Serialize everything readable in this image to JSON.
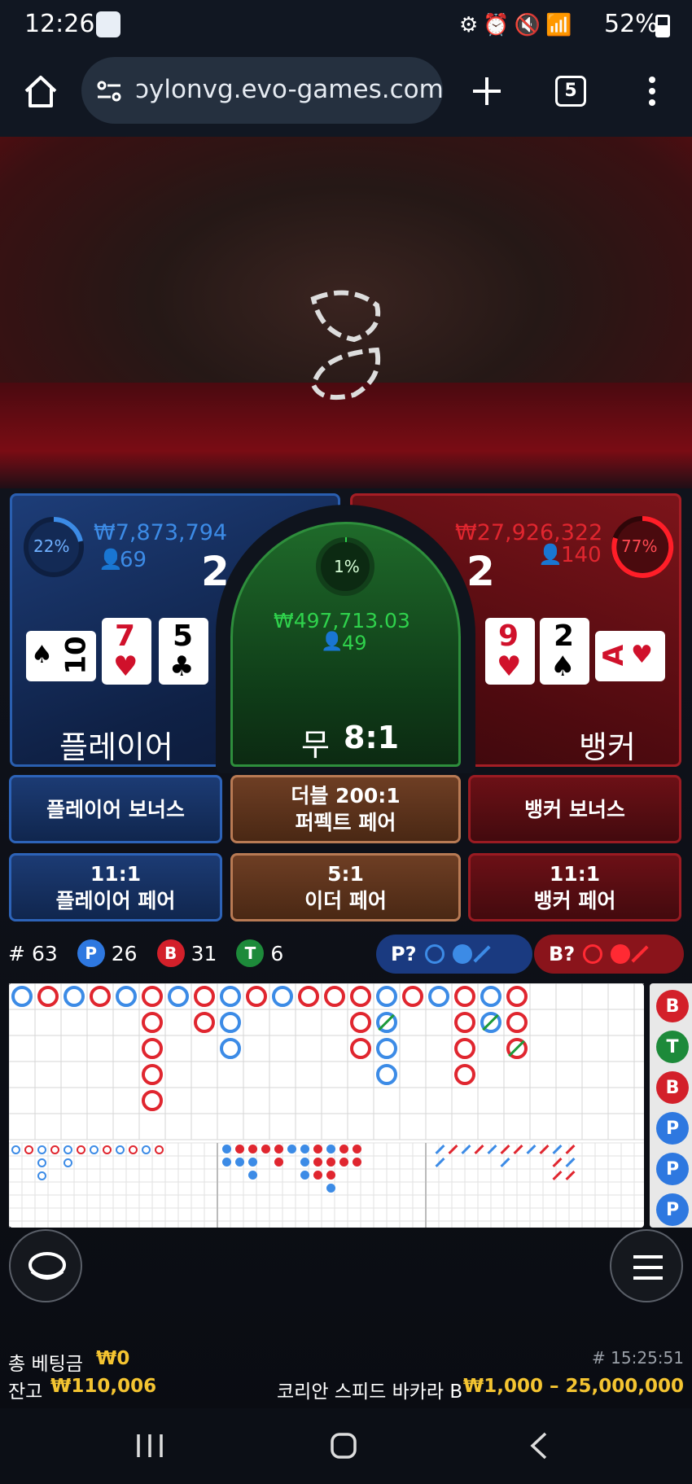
{
  "status_bar": {
    "time": "12:26",
    "battery": "52%"
  },
  "browser": {
    "url": "ɔylonvg.evo-games.com",
    "tab_count": "5"
  },
  "player": {
    "percent": "22%",
    "amount": "₩7,873,794",
    "bettors": "69",
    "score": "2",
    "label": "플레이어",
    "cards": [
      {
        "rank": "10",
        "suit": "♠",
        "color": "#000",
        "rotated": true
      },
      {
        "rank": "7",
        "suit": "♥",
        "color": "#d0112b"
      },
      {
        "rank": "5",
        "suit": "♣",
        "color": "#000"
      }
    ]
  },
  "tie": {
    "percent": "1%",
    "amount": "₩497,713.03",
    "bettors": "49",
    "label": "무",
    "odds": "8:1"
  },
  "banker": {
    "percent": "77%",
    "amount": "₩27,926,322",
    "bettors": "140",
    "score": "2",
    "label": "뱅커",
    "cards": [
      {
        "rank": "9",
        "suit": "♥",
        "color": "#d0112b"
      },
      {
        "rank": "2",
        "suit": "♠",
        "color": "#000"
      },
      {
        "rank": "A",
        "suit": "♥",
        "color": "#d0112b",
        "rotated": true
      }
    ]
  },
  "side_bets": {
    "player_bonus": "플레이어 보너스",
    "perfect_pair_odds": "더블 200:1",
    "perfect_pair": "퍼펙트 페어",
    "banker_bonus": "뱅커 보너스",
    "player_pair_odds": "11:1",
    "player_pair": "플레이어 페어",
    "either_pair_odds": "5:1",
    "either_pair": "이더 페어",
    "banker_pair_odds": "11:1",
    "banker_pair": "뱅커 페어"
  },
  "stats": {
    "rounds_label": "#",
    "rounds": "63",
    "p_label": "P",
    "p_count": "26",
    "b_label": "B",
    "b_count": "31",
    "t_label": "T",
    "t_count": "6"
  },
  "predict": {
    "player": "P?",
    "banker": "B?"
  },
  "side_road": [
    "B",
    "T",
    "B",
    "P",
    "P",
    "P"
  ],
  "footer": {
    "total_bet_label": "총 베팅금",
    "total_bet": "₩0",
    "balance_label": "잔고",
    "balance": "₩110,006",
    "round_id": "# 15:25:51",
    "table_name": "코리안 스피드 바카라 B",
    "limits": "₩1,000 – 25,000,000"
  },
  "colors": {
    "player_blue": "#3c8be6",
    "banker_red": "#e0262f",
    "tie_green": "#2fd24c",
    "gold": "#f4c431"
  }
}
